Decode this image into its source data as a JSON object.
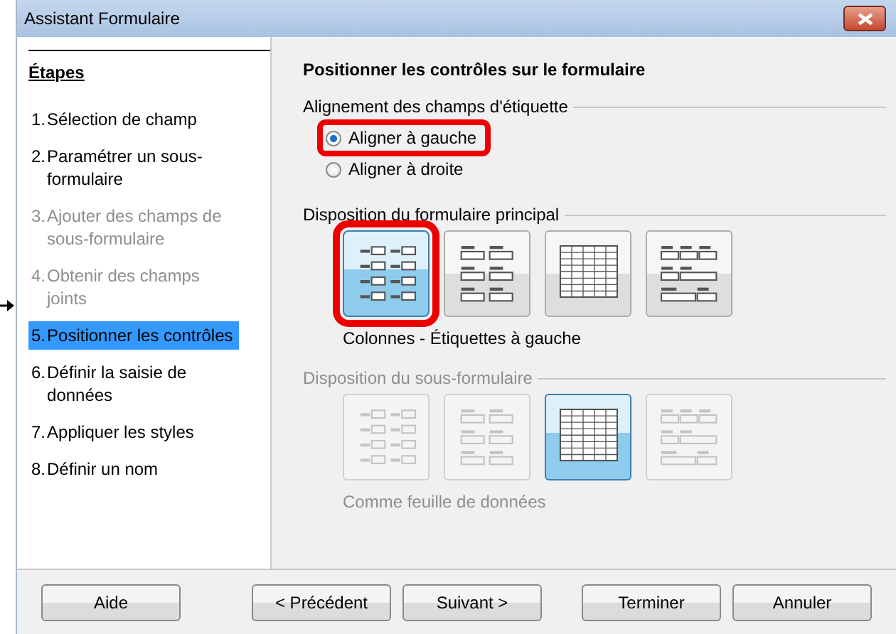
{
  "window": {
    "title": "Assistant Formulaire"
  },
  "sidebar": {
    "heading": "Étapes",
    "items": [
      {
        "number": "1.",
        "label": "Sélection de champ",
        "disabled": false,
        "selected": false
      },
      {
        "number": "2.",
        "label": "Paramétrer un sous-formulaire",
        "disabled": false,
        "selected": false
      },
      {
        "number": "3.",
        "label": "Ajouter des champs de sous-formulaire",
        "disabled": true,
        "selected": false
      },
      {
        "number": "4.",
        "label": "Obtenir des champs joints",
        "disabled": true,
        "selected": false
      },
      {
        "number": "5.",
        "label": "Positionner les contrôles",
        "disabled": false,
        "selected": true
      },
      {
        "number": "6.",
        "label": "Définir la saisie de données",
        "disabled": false,
        "selected": false
      },
      {
        "number": "7.",
        "label": "Appliquer les styles",
        "disabled": false,
        "selected": false
      },
      {
        "number": "8.",
        "label": "Définir un nom",
        "disabled": false,
        "selected": false
      }
    ]
  },
  "page_title": "Positionner les contrôles sur le formulaire",
  "label_alignment": {
    "title": "Alignement des champs d'étiquette",
    "options": [
      {
        "label": "Aligner à gauche",
        "selected": true,
        "highlighted": true
      },
      {
        "label": "Aligner à droite",
        "selected": false,
        "highlighted": false
      }
    ]
  },
  "main_layout": {
    "title": "Disposition du formulaire principal",
    "disabled": false,
    "caption": "Colonnes - Étiquettes à gauche",
    "buttons": [
      {
        "kind": "columns-left",
        "selected": true,
        "highlighted": true
      },
      {
        "kind": "columns-top",
        "selected": false,
        "highlighted": false
      },
      {
        "kind": "table",
        "selected": false,
        "highlighted": false
      },
      {
        "kind": "blocks",
        "selected": false,
        "highlighted": false
      }
    ]
  },
  "sub_layout": {
    "title": "Disposition du sous-formulaire",
    "disabled": true,
    "caption": "Comme feuille de données",
    "buttons": [
      {
        "kind": "columns-left",
        "selected": false,
        "highlighted": false
      },
      {
        "kind": "columns-top",
        "selected": false,
        "highlighted": false
      },
      {
        "kind": "table",
        "selected": true,
        "highlighted": false
      },
      {
        "kind": "blocks",
        "selected": false,
        "highlighted": false
      }
    ]
  },
  "help_button": {
    "label": "Aide"
  },
  "buttons": [
    {
      "label": "< Précédent"
    },
    {
      "label": "Suivant >"
    },
    {
      "label": "Terminer"
    },
    {
      "label": "Annuler"
    }
  ]
}
